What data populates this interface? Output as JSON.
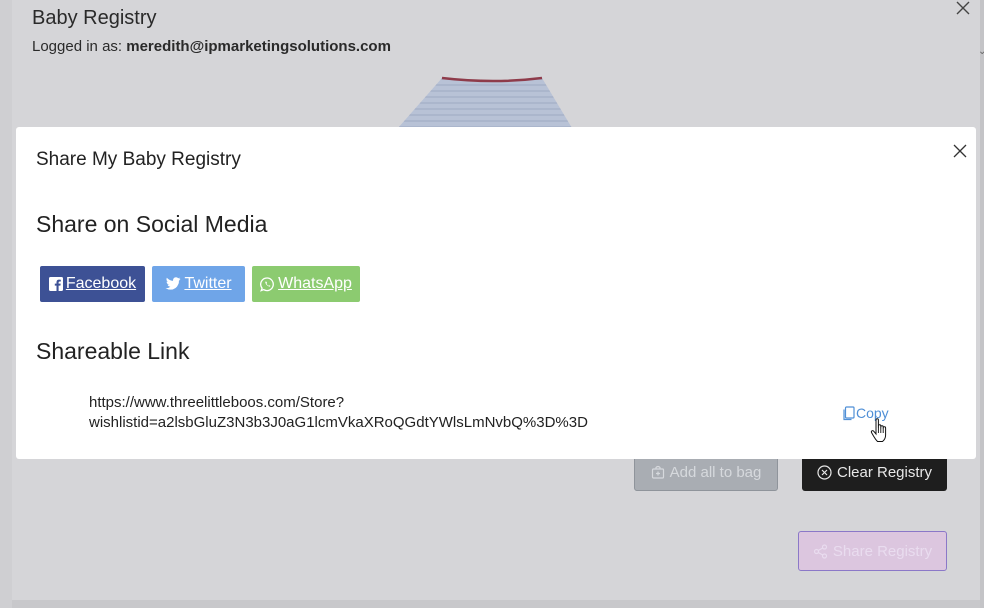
{
  "background": {
    "title": "Baby Registry",
    "login_prefix": "Logged in as:",
    "login_email": "meredith@ipmarketingsolutions.com",
    "add_all_label": "Add all to bag",
    "clear_label": "Clear Registry",
    "share_label": "Share Registry"
  },
  "modal": {
    "title": "Share My Baby Registry",
    "social_heading": "Share on Social Media",
    "social_buttons": [
      {
        "label": "Facebook",
        "icon": "facebook-icon",
        "color": "#3d5195"
      },
      {
        "label": "Twitter",
        "icon": "twitter-icon",
        "color": "#6fa5e8"
      },
      {
        "label": "WhatsApp",
        "icon": "whatsapp-icon",
        "color": "#8ccb70"
      }
    ],
    "link_heading": "Shareable Link",
    "link_line1": "https://www.threelittleboos.com/Store?",
    "link_line2": "wishlistid=a2lsbGluZ3N3b3J0aG1lcmVkaXRoQGdtYWlsLmNvbQ%3D%3D",
    "copy_label": "Copy"
  },
  "colors": {
    "copy_link": "#4f8fd6",
    "clear_button": "#1e1e1e"
  }
}
